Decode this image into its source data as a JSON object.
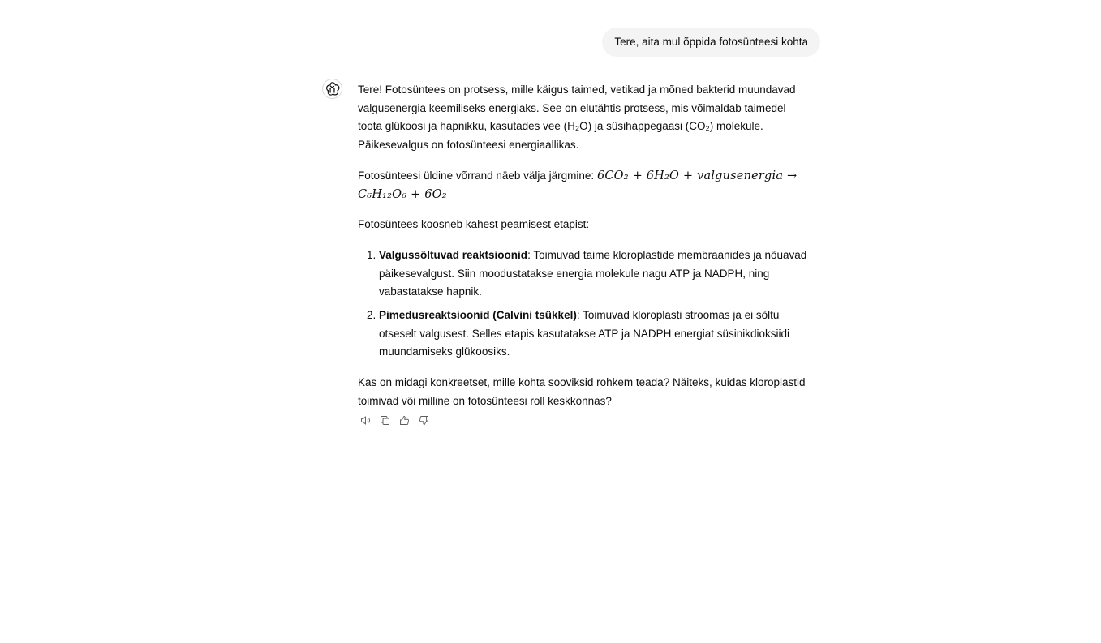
{
  "conversation": {
    "user_message": "Tere, aita mul õppida fotosünteesi kohta",
    "assistant": {
      "avatar_icon": "gpt-logo-icon",
      "intro": "Tere! Fotosüntees on protsess, mille käigus taimed, vetikad ja mõned bakterid muundavad valgusenergia keemiliseks energiaks. See on elutähtis protsess, mis võimaldab taimedel toota glükoosi ja hapnikku, kasutades vee (H₂O) ja süsihappegaasi (CO₂) molekule. Päikesevalgus on fotosünteesi energiaallikas.",
      "equation_intro": "Fotosünteesi üldine võrrand näeb välja järgmine: ",
      "equation": {
        "lhs": "6CO₂ + 6H₂O + valgusenergia →",
        "rhs": "C₆H₁₂O₆ + 6O₂"
      },
      "stages_intro": "Fotosüntees koosneb kahest peamisest etapist:",
      "stages": [
        {
          "title": "Valgussõltuvad reaktsioonid",
          "text": ": Toimuvad taime kloroplastide membraanides ja nõuavad päikesevalgust. Siin moodustatakse energia molekule nagu ATP ja NADPH, ning vabastatakse hapnik."
        },
        {
          "title": "Pimedusreaktsioonid (Calvini tsükkel)",
          "text": ": Toimuvad kloroplasti stroomas ja ei sõltu otseselt valgusest. Selles etapis kasutatakse ATP ja NADPH energiat süsinikdioksiidi muundamiseks glükoosiks."
        }
      ],
      "closing": "Kas on midagi konkreetset, mille kohta sooviksid rohkem teada? Näiteks, kuidas kloroplastid toimivad või milline on fotosünteesi roll keskkonnas?"
    },
    "actions": [
      {
        "name": "read-aloud-icon"
      },
      {
        "name": "copy-icon"
      },
      {
        "name": "thumbs-up-icon"
      },
      {
        "name": "thumbs-down-icon"
      }
    ]
  }
}
